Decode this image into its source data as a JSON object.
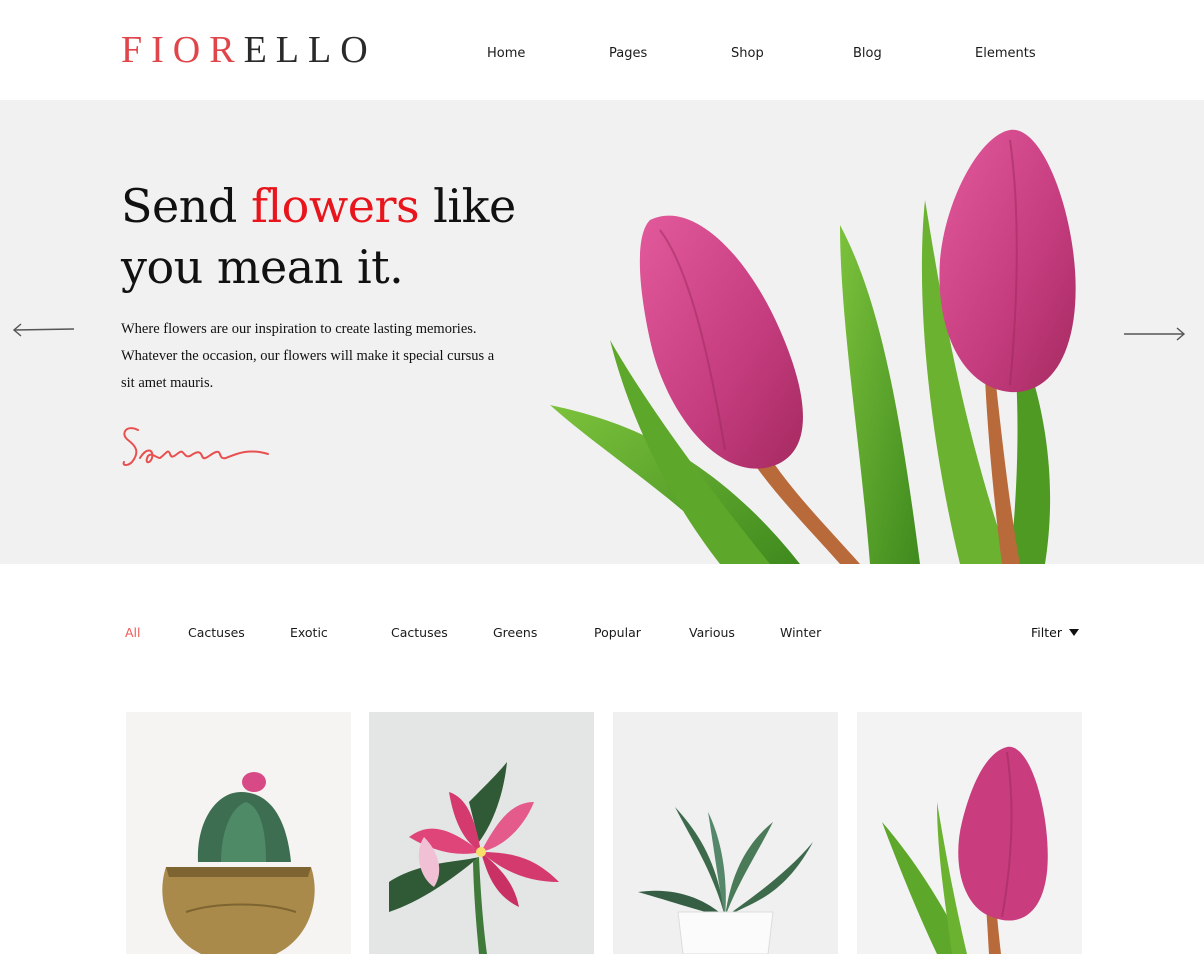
{
  "header": {
    "logo_part1": "FIOR",
    "logo_part2": "ELLO",
    "nav": [
      "Home",
      "Pages",
      "Shop",
      "Blog",
      "Elements"
    ]
  },
  "hero": {
    "title_part1": "Send ",
    "title_accent": "flowers",
    "title_part2": " like you mean it.",
    "description": "Where flowers are our inspiration to create lasting memories. Whatever the occasion, our flowers will make it special cursus a sit amet mauris.",
    "signature": "Sara",
    "accent_color": "#e8151d"
  },
  "filters": {
    "items": [
      "All",
      "Cactuses",
      "Exotic",
      "Cactuses",
      "Greens",
      "Popular",
      "Various",
      "Winter"
    ],
    "active_index": 0,
    "dropdown_label": "Filter"
  },
  "products": [
    {
      "name": "cactus-in-brass-pot"
    },
    {
      "name": "pink-lily"
    },
    {
      "name": "aloe-in-white-pot"
    },
    {
      "name": "pink-tulip"
    }
  ]
}
